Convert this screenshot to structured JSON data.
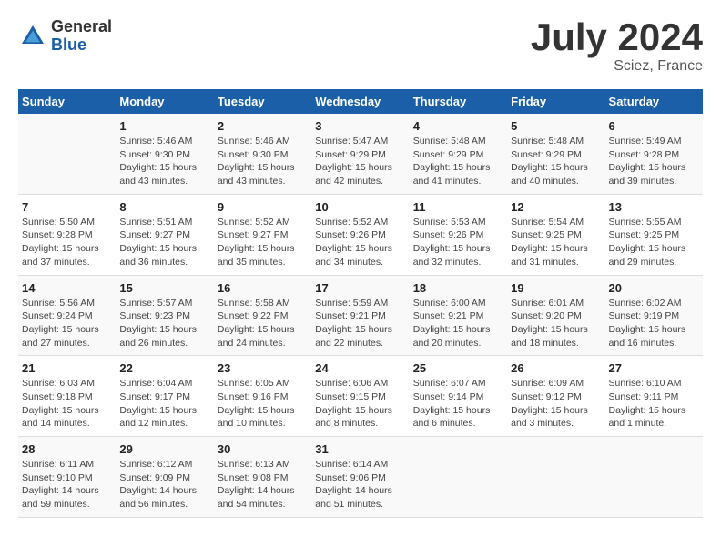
{
  "logo": {
    "general": "General",
    "blue": "Blue"
  },
  "title": {
    "month_year": "July 2024",
    "location": "Sciez, France"
  },
  "days_of_week": [
    "Sunday",
    "Monday",
    "Tuesday",
    "Wednesday",
    "Thursday",
    "Friday",
    "Saturday"
  ],
  "weeks": [
    [
      {
        "day": "",
        "info": ""
      },
      {
        "day": "1",
        "info": "Sunrise: 5:46 AM\nSunset: 9:30 PM\nDaylight: 15 hours\nand 43 minutes."
      },
      {
        "day": "2",
        "info": "Sunrise: 5:46 AM\nSunset: 9:30 PM\nDaylight: 15 hours\nand 43 minutes."
      },
      {
        "day": "3",
        "info": "Sunrise: 5:47 AM\nSunset: 9:29 PM\nDaylight: 15 hours\nand 42 minutes."
      },
      {
        "day": "4",
        "info": "Sunrise: 5:48 AM\nSunset: 9:29 PM\nDaylight: 15 hours\nand 41 minutes."
      },
      {
        "day": "5",
        "info": "Sunrise: 5:48 AM\nSunset: 9:29 PM\nDaylight: 15 hours\nand 40 minutes."
      },
      {
        "day": "6",
        "info": "Sunrise: 5:49 AM\nSunset: 9:28 PM\nDaylight: 15 hours\nand 39 minutes."
      }
    ],
    [
      {
        "day": "7",
        "info": "Sunrise: 5:50 AM\nSunset: 9:28 PM\nDaylight: 15 hours\nand 37 minutes."
      },
      {
        "day": "8",
        "info": "Sunrise: 5:51 AM\nSunset: 9:27 PM\nDaylight: 15 hours\nand 36 minutes."
      },
      {
        "day": "9",
        "info": "Sunrise: 5:52 AM\nSunset: 9:27 PM\nDaylight: 15 hours\nand 35 minutes."
      },
      {
        "day": "10",
        "info": "Sunrise: 5:52 AM\nSunset: 9:26 PM\nDaylight: 15 hours\nand 34 minutes."
      },
      {
        "day": "11",
        "info": "Sunrise: 5:53 AM\nSunset: 9:26 PM\nDaylight: 15 hours\nand 32 minutes."
      },
      {
        "day": "12",
        "info": "Sunrise: 5:54 AM\nSunset: 9:25 PM\nDaylight: 15 hours\nand 31 minutes."
      },
      {
        "day": "13",
        "info": "Sunrise: 5:55 AM\nSunset: 9:25 PM\nDaylight: 15 hours\nand 29 minutes."
      }
    ],
    [
      {
        "day": "14",
        "info": "Sunrise: 5:56 AM\nSunset: 9:24 PM\nDaylight: 15 hours\nand 27 minutes."
      },
      {
        "day": "15",
        "info": "Sunrise: 5:57 AM\nSunset: 9:23 PM\nDaylight: 15 hours\nand 26 minutes."
      },
      {
        "day": "16",
        "info": "Sunrise: 5:58 AM\nSunset: 9:22 PM\nDaylight: 15 hours\nand 24 minutes."
      },
      {
        "day": "17",
        "info": "Sunrise: 5:59 AM\nSunset: 9:21 PM\nDaylight: 15 hours\nand 22 minutes."
      },
      {
        "day": "18",
        "info": "Sunrise: 6:00 AM\nSunset: 9:21 PM\nDaylight: 15 hours\nand 20 minutes."
      },
      {
        "day": "19",
        "info": "Sunrise: 6:01 AM\nSunset: 9:20 PM\nDaylight: 15 hours\nand 18 minutes."
      },
      {
        "day": "20",
        "info": "Sunrise: 6:02 AM\nSunset: 9:19 PM\nDaylight: 15 hours\nand 16 minutes."
      }
    ],
    [
      {
        "day": "21",
        "info": "Sunrise: 6:03 AM\nSunset: 9:18 PM\nDaylight: 15 hours\nand 14 minutes."
      },
      {
        "day": "22",
        "info": "Sunrise: 6:04 AM\nSunset: 9:17 PM\nDaylight: 15 hours\nand 12 minutes."
      },
      {
        "day": "23",
        "info": "Sunrise: 6:05 AM\nSunset: 9:16 PM\nDaylight: 15 hours\nand 10 minutes."
      },
      {
        "day": "24",
        "info": "Sunrise: 6:06 AM\nSunset: 9:15 PM\nDaylight: 15 hours\nand 8 minutes."
      },
      {
        "day": "25",
        "info": "Sunrise: 6:07 AM\nSunset: 9:14 PM\nDaylight: 15 hours\nand 6 minutes."
      },
      {
        "day": "26",
        "info": "Sunrise: 6:09 AM\nSunset: 9:12 PM\nDaylight: 15 hours\nand 3 minutes."
      },
      {
        "day": "27",
        "info": "Sunrise: 6:10 AM\nSunset: 9:11 PM\nDaylight: 15 hours\nand 1 minute."
      }
    ],
    [
      {
        "day": "28",
        "info": "Sunrise: 6:11 AM\nSunset: 9:10 PM\nDaylight: 14 hours\nand 59 minutes."
      },
      {
        "day": "29",
        "info": "Sunrise: 6:12 AM\nSunset: 9:09 PM\nDaylight: 14 hours\nand 56 minutes."
      },
      {
        "day": "30",
        "info": "Sunrise: 6:13 AM\nSunset: 9:08 PM\nDaylight: 14 hours\nand 54 minutes."
      },
      {
        "day": "31",
        "info": "Sunrise: 6:14 AM\nSunset: 9:06 PM\nDaylight: 14 hours\nand 51 minutes."
      },
      {
        "day": "",
        "info": ""
      },
      {
        "day": "",
        "info": ""
      },
      {
        "day": "",
        "info": ""
      }
    ]
  ]
}
